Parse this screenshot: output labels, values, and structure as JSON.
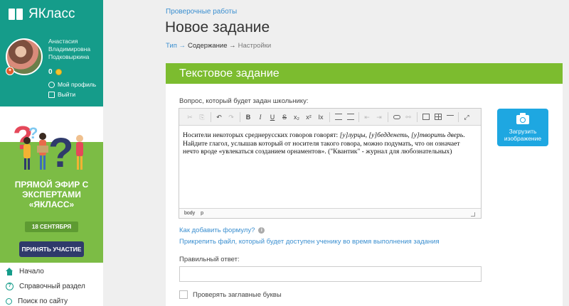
{
  "brand": {
    "name": "ЯКласс",
    "accent": "#159c8a",
    "green": "#7cbc2f",
    "link": "#3b8fd0"
  },
  "user": {
    "name": "Анастасия Владимировна Подковыркина",
    "score": "0",
    "profile_link": "Мой профиль",
    "logout_link": "Выйти"
  },
  "promo": {
    "title": "ПРЯМОЙ ЭФИР С ЭКСПЕРТАМИ «ЯКЛАСС»",
    "date": "18 СЕНТЯБРЯ",
    "button": "ПРИНЯТЬ УЧАСТИЕ"
  },
  "nav": {
    "items": [
      {
        "label": "Начало",
        "icon": "home-icon"
      },
      {
        "label": "Справочный раздел",
        "icon": "help-icon"
      },
      {
        "label": "Поиск по сайту",
        "icon": "search-icon"
      }
    ]
  },
  "header": {
    "breadcrumb": "Проверочные работы",
    "title": "Новое задание",
    "steps": {
      "step1": "Тип →",
      "step2": "Содержание →",
      "step3": "Настройки"
    }
  },
  "card": {
    "title": "Текстовое задание",
    "question_label": "Вопрос, который будет задан школьнику:",
    "editor": {
      "text_part1": "Носители некоторых среднерусских говоров говорят: ",
      "text_italic1": "[у]лурцы, [у]бедденеть, [у]творить дверь",
      "text_part2": ". Найдите глагол, услышав который от носителя такого говора, можно подумать, что он означает нечто вроде «увлекаться созданием орнаментов». (\"Квантик\" - журнал для любознательных)",
      "status_path": [
        "body",
        "p"
      ]
    },
    "upload_button": "Загрузить изображение",
    "formula_link": "Как добавить формулу?",
    "attach_link": "Прикрепить файл, который будет доступен ученику во время выполнения задания",
    "answer_label": "Правильный ответ:",
    "answer_value": "",
    "check_caps_label": "Проверять заглавные буквы",
    "check_caps_checked": false
  }
}
